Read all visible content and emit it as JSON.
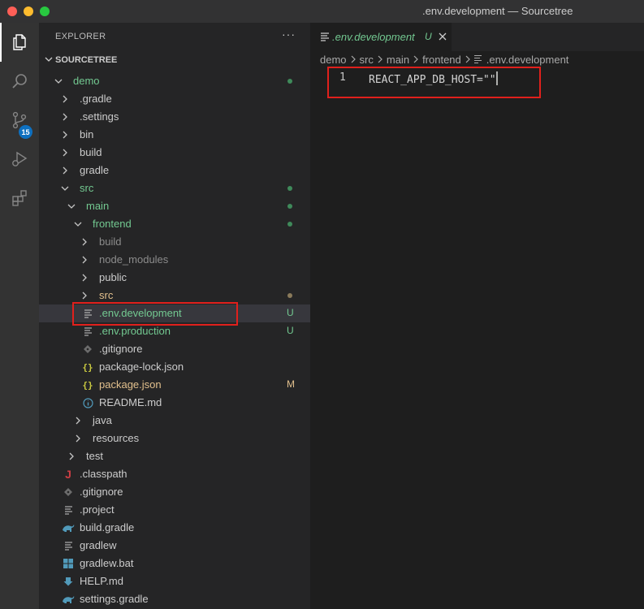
{
  "window": {
    "title": ".env.development — Sourcetree"
  },
  "activity_bar": {
    "items": [
      {
        "icon": "files-icon",
        "active": true
      },
      {
        "icon": "search-icon"
      },
      {
        "icon": "source-control-icon",
        "badge": "15"
      },
      {
        "icon": "run-debug-icon"
      },
      {
        "icon": "extensions-icon"
      }
    ]
  },
  "explorer": {
    "header": "EXPLORER",
    "more": "···",
    "section": "SOURCETREE",
    "tree": [
      {
        "name": "demo",
        "type": "folder",
        "open": true,
        "depth": 0,
        "color": "git",
        "status": "dot"
      },
      {
        "name": ".gradle",
        "type": "folder",
        "open": false,
        "depth": 1,
        "color": "def"
      },
      {
        "name": ".settings",
        "type": "folder",
        "open": false,
        "depth": 1,
        "color": "def"
      },
      {
        "name": "bin",
        "type": "folder",
        "open": false,
        "depth": 1,
        "color": "def"
      },
      {
        "name": "build",
        "type": "folder",
        "open": false,
        "depth": 1,
        "color": "def"
      },
      {
        "name": "gradle",
        "type": "folder",
        "open": false,
        "depth": 1,
        "color": "def"
      },
      {
        "name": "src",
        "type": "folder",
        "open": true,
        "depth": 1,
        "color": "git",
        "status": "dot"
      },
      {
        "name": "main",
        "type": "folder",
        "open": true,
        "depth": 2,
        "color": "git",
        "status": "dot"
      },
      {
        "name": "frontend",
        "type": "folder",
        "open": true,
        "depth": 3,
        "color": "git",
        "status": "dot"
      },
      {
        "name": "build",
        "type": "folder",
        "open": false,
        "depth": 4,
        "color": "ign"
      },
      {
        "name": "node_modules",
        "type": "folder",
        "open": false,
        "depth": 4,
        "color": "ign"
      },
      {
        "name": "public",
        "type": "folder",
        "open": false,
        "depth": 4,
        "color": "def"
      },
      {
        "name": "src",
        "type": "folder",
        "open": false,
        "depth": 4,
        "color": "mod",
        "status": "dot-mod"
      },
      {
        "name": ".env.development",
        "type": "file",
        "icon": "lines",
        "depth": 4,
        "color": "git",
        "status": "U",
        "selected": true
      },
      {
        "name": ".env.production",
        "type": "file",
        "icon": "lines",
        "depth": 4,
        "color": "git",
        "status": "U"
      },
      {
        "name": ".gitignore",
        "type": "file",
        "icon": "git",
        "depth": 4,
        "color": "def"
      },
      {
        "name": "package-lock.json",
        "type": "file",
        "icon": "json",
        "depth": 4,
        "color": "def"
      },
      {
        "name": "package.json",
        "type": "file",
        "icon": "json",
        "depth": 4,
        "color": "mod",
        "status": "M"
      },
      {
        "name": "README.md",
        "type": "file",
        "icon": "info",
        "depth": 4,
        "color": "def"
      },
      {
        "name": "java",
        "type": "folder",
        "open": false,
        "depth": 3,
        "color": "def"
      },
      {
        "name": "resources",
        "type": "folder",
        "open": false,
        "depth": 3,
        "color": "def"
      },
      {
        "name": "test",
        "type": "folder",
        "open": false,
        "depth": 2,
        "color": "def"
      },
      {
        "name": ".classpath",
        "type": "file",
        "icon": "java",
        "depth": 1,
        "color": "def"
      },
      {
        "name": ".gitignore",
        "type": "file",
        "icon": "git",
        "depth": 1,
        "color": "def"
      },
      {
        "name": ".project",
        "type": "file",
        "icon": "lines",
        "depth": 1,
        "color": "def"
      },
      {
        "name": "build.gradle",
        "type": "file",
        "icon": "gradle",
        "depth": 1,
        "color": "def"
      },
      {
        "name": "gradlew",
        "type": "file",
        "icon": "lines",
        "depth": 1,
        "color": "def"
      },
      {
        "name": "gradlew.bat",
        "type": "file",
        "icon": "windows",
        "depth": 1,
        "color": "def"
      },
      {
        "name": "HELP.md",
        "type": "file",
        "icon": "markdown",
        "depth": 1,
        "color": "def"
      },
      {
        "name": "settings.gradle",
        "type": "file",
        "icon": "gradle",
        "depth": 1,
        "color": "def"
      }
    ]
  },
  "editor": {
    "tab": {
      "name": ".env.development",
      "status": "U"
    },
    "breadcrumb": [
      "demo",
      "src",
      "main",
      "frontend",
      ".env.development"
    ],
    "lines": [
      {
        "number": "1",
        "code": "REACT_APP_DB_HOST=\"\""
      }
    ]
  },
  "colors": {
    "git": "#73c991",
    "mod": "#e2c08d",
    "ign": "#8c8c8c",
    "def": "#cccccc",
    "highlight": "#e0201c",
    "badge": "#0e70c0"
  }
}
